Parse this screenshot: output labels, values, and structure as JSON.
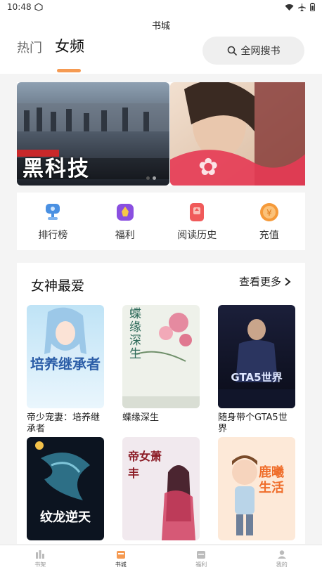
{
  "status_bar": {
    "time": "10:48"
  },
  "header": {
    "title": "书城",
    "tabs": [
      {
        "label": "热门"
      },
      {
        "label": "女频"
      }
    ],
    "search_label": "全网搜书"
  },
  "banner": {
    "slides": [
      {
        "text": "黑科技"
      },
      {
        "text": ""
      }
    ]
  },
  "quick_menu": [
    {
      "label": "排行榜",
      "icon": "trophy-icon",
      "color": "#4a90e2"
    },
    {
      "label": "福利",
      "icon": "gift-icon",
      "color": "#8a4fe0"
    },
    {
      "label": "阅读历史",
      "icon": "history-icon",
      "color": "#f05a5a"
    },
    {
      "label": "充值",
      "icon": "recharge-icon",
      "color": "#f59a3a"
    }
  ],
  "section": {
    "title": "女神最爱",
    "more_label": "查看更多",
    "books": [
      {
        "title": "帝少宠妻：培养继承者",
        "cover_text": "培养继承者"
      },
      {
        "title": "蝶缘深生",
        "cover_text": "蝶缘深生"
      },
      {
        "title": "随身带个GTA5世界",
        "cover_text": "GTA5世界"
      },
      {
        "title": "",
        "cover_text": "纹龙逆天"
      },
      {
        "title": "",
        "cover_text": "帝女萧丰"
      },
      {
        "title": "",
        "cover_text": "鹿曦生活"
      }
    ]
  },
  "bottom_nav": [
    {
      "label": "书架",
      "icon": "bookshelf-icon"
    },
    {
      "label": "书城",
      "icon": "bookstore-icon",
      "active": true
    },
    {
      "label": "福利",
      "icon": "welfare-icon"
    },
    {
      "label": "我的",
      "icon": "profile-icon"
    }
  ],
  "colors": {
    "accent": "#f59a52"
  }
}
